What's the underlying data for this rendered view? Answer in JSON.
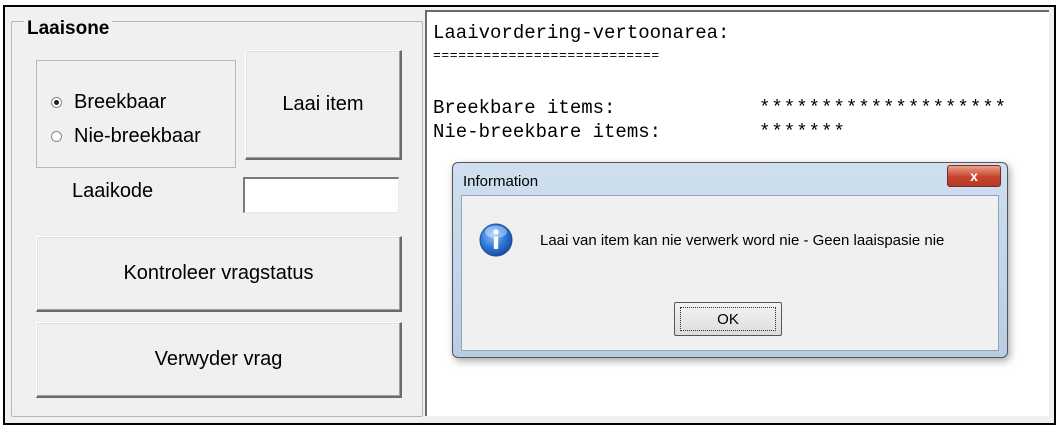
{
  "group": {
    "title": "Laaisone",
    "radio_options": [
      "Breekbaar",
      "Nie-breekbaar"
    ],
    "selected_option": "Breekbaar",
    "load_button": "Laai item",
    "code_label": "Laaikode",
    "code_value": "",
    "check_button": "Kontroleer vragstatus",
    "remove_button": "Verwyder vrag"
  },
  "display": {
    "heading": "Laaivordering-vertoonarea:",
    "underline": "===========================",
    "rows": [
      {
        "label": "Breekbare items:",
        "value": "********************"
      },
      {
        "label": "Nie-breekbare items:",
        "value": "*******"
      }
    ]
  },
  "dialog": {
    "title": "Information",
    "close_label": "x",
    "message": "Laai van item kan nie verwerk word nie - Geen laaispasie nie",
    "ok_label": "OK",
    "icon": "info-icon"
  }
}
